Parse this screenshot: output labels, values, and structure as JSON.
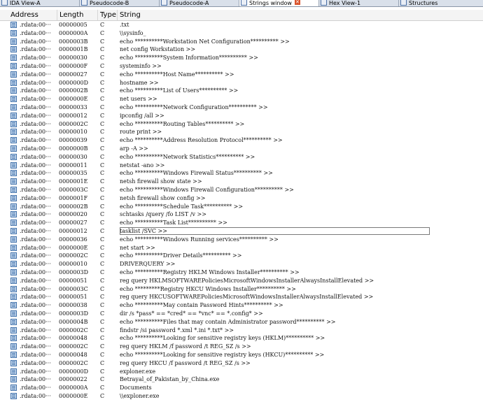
{
  "tabs": [
    {
      "label": "IDA View-A",
      "active": false
    },
    {
      "label": "Pseudocode-B",
      "active": false
    },
    {
      "label": "Pseudocode-A",
      "active": false
    },
    {
      "label": "Strings window",
      "active": true
    },
    {
      "label": "Hex View-1",
      "active": false
    },
    {
      "label": "Structures",
      "active": false
    }
  ],
  "columns": {
    "address": "Address",
    "length": "Length",
    "type": "Type",
    "string": "String"
  },
  "selected_index": 25,
  "rows": [
    {
      "address": ".rdata:00···",
      "length": "00000005",
      "type": "C",
      "string": ".txt"
    },
    {
      "address": ".rdata:00···",
      "length": "0000000A",
      "type": "C",
      "string": "\\\\sysinfo_"
    },
    {
      "address": ".rdata:00···",
      "length": "0000003B",
      "type": "C",
      "string": "echo **********Workstation Net Configuration********** >>"
    },
    {
      "address": ".rdata:00···",
      "length": "0000001B",
      "type": "C",
      "string": "net config Workstation >>"
    },
    {
      "address": ".rdata:00···",
      "length": "00000030",
      "type": "C",
      "string": "echo **********System Information********** >>"
    },
    {
      "address": ".rdata:00···",
      "length": "0000000F",
      "type": "C",
      "string": "systeminfo >>"
    },
    {
      "address": ".rdata:00···",
      "length": "00000027",
      "type": "C",
      "string": "echo **********Host Name********** >>"
    },
    {
      "address": ".rdata:00···",
      "length": "0000000D",
      "type": "C",
      "string": "hostname >>"
    },
    {
      "address": ".rdata:00···",
      "length": "0000002B",
      "type": "C",
      "string": "echo **********List of Users********** >>"
    },
    {
      "address": ".rdata:00···",
      "length": "0000000E",
      "type": "C",
      "string": "net users >>"
    },
    {
      "address": ".rdata:00···",
      "length": "00000033",
      "type": "C",
      "string": "echo **********Network Configuration********** >>"
    },
    {
      "address": ".rdata:00···",
      "length": "00000012",
      "type": "C",
      "string": "ipconfig /all >>"
    },
    {
      "address": ".rdata:00···",
      "length": "0000002C",
      "type": "C",
      "string": "echo **********Routing Tables********** >>"
    },
    {
      "address": ".rdata:00···",
      "length": "00000010",
      "type": "C",
      "string": "route print >>"
    },
    {
      "address": ".rdata:00···",
      "length": "00000039",
      "type": "C",
      "string": "echo **********Address Resolution Protocol********** >>"
    },
    {
      "address": ".rdata:00···",
      "length": "0000000B",
      "type": "C",
      "string": "arp -A >>"
    },
    {
      "address": ".rdata:00···",
      "length": "00000030",
      "type": "C",
      "string": "echo **********Network Statistics********** >>"
    },
    {
      "address": ".rdata:00···",
      "length": "00000011",
      "type": "C",
      "string": "netstat -ano >>"
    },
    {
      "address": ".rdata:00···",
      "length": "00000035",
      "type": "C",
      "string": "echo **********Windows Firewall Status********** >>"
    },
    {
      "address": ".rdata:00···",
      "length": "0000001E",
      "type": "C",
      "string": "netsh firewall show state >>"
    },
    {
      "address": ".rdata:00···",
      "length": "0000003C",
      "type": "C",
      "string": "echo **********Windows Firewall Configuration********** >>"
    },
    {
      "address": ".rdata:00···",
      "length": "0000001F",
      "type": "C",
      "string": "netsh firewall show config >>"
    },
    {
      "address": ".rdata:00···",
      "length": "0000002B",
      "type": "C",
      "string": "echo **********Schedule Task********** >>"
    },
    {
      "address": ".rdata:00···",
      "length": "00000020",
      "type": "C",
      "string": "schtasks /query /fo LIST /v >>"
    },
    {
      "address": ".rdata:00···",
      "length": "00000027",
      "type": "C",
      "string": "echo **********Task List********** >>"
    },
    {
      "address": ".rdata:00···",
      "length": "00000012",
      "type": "C",
      "string": "tasklist /SVC >>"
    },
    {
      "address": ".rdata:00···",
      "length": "00000036",
      "type": "C",
      "string": "echo **********Windows Running services********** >>"
    },
    {
      "address": ".rdata:00···",
      "length": "0000000E",
      "type": "C",
      "string": "net start >>"
    },
    {
      "address": ".rdata:00···",
      "length": "0000002C",
      "type": "C",
      "string": "echo **********Driver Details********** >>"
    },
    {
      "address": ".rdata:00···",
      "length": "00000010",
      "type": "C",
      "string": "DRIVERQUERY >>"
    },
    {
      "address": ".rdata:00···",
      "length": "0000003D",
      "type": "C",
      "string": "echo **********Registry HKLM Windows Installer********** >>"
    },
    {
      "address": ".rdata:00···",
      "length": "00000051",
      "type": "C",
      "string": "reg query HKLMSOFTWAREPoliciesMicrosoftWindowsInstallerAlwaysInstallElevated >>"
    },
    {
      "address": ".rdata:00···",
      "length": "0000003C",
      "type": "C",
      "string": "echo *********Registry HKCU Windows Installer********** >>"
    },
    {
      "address": ".rdata:00···",
      "length": "00000051",
      "type": "C",
      "string": "reg query HKCUSOFTWAREPoliciesMicrosoftWindowsInstallerAlwaysInstallElevated >>"
    },
    {
      "address": ".rdata:00···",
      "length": "00000038",
      "type": "C",
      "string": "echo **********May contain Password Hints********** >>"
    },
    {
      "address": ".rdata:00···",
      "length": "0000003D",
      "type": "C",
      "string": "dir /s *pass* == *cred* == *vnc* == *.config* >>"
    },
    {
      "address": ".rdata:00···",
      "length": "0000004B",
      "type": "C",
      "string": "echo **********Files that may contain Administrator password********** >>"
    },
    {
      "address": ".rdata:00···",
      "length": "0000002C",
      "type": "C",
      "string": "findstr /si password *.xml *.ini *.txt* >>"
    },
    {
      "address": ".rdata:00···",
      "length": "00000048",
      "type": "C",
      "string": "echo **********Looking for sensitive registry keys (HKLM)********** >>"
    },
    {
      "address": ".rdata:00···",
      "length": "0000002C",
      "type": "C",
      "string": "reg query HKLM /f password /t REG_SZ /s >>"
    },
    {
      "address": ".rdata:00···",
      "length": "00000048",
      "type": "C",
      "string": "echo **********Looking for sensitive registry keys (HKCU)********** >>"
    },
    {
      "address": ".rdata:00···",
      "length": "0000002C",
      "type": "C",
      "string": "reg query HKCU /f password /t REG_SZ /s >>"
    },
    {
      "address": ".rdata:00···",
      "length": "0000000D",
      "type": "C",
      "string": "exploner.exe"
    },
    {
      "address": ".rdata:00···",
      "length": "00000022",
      "type": "C",
      "string": "Betrayal_of_Pakistan_by_China.exe"
    },
    {
      "address": ".rdata:00···",
      "length": "0000000A",
      "type": "C",
      "string": "Documents"
    },
    {
      "address": ".rdata:00···",
      "length": "0000000E",
      "type": "C",
      "string": "\\\\exploner.exe"
    }
  ]
}
